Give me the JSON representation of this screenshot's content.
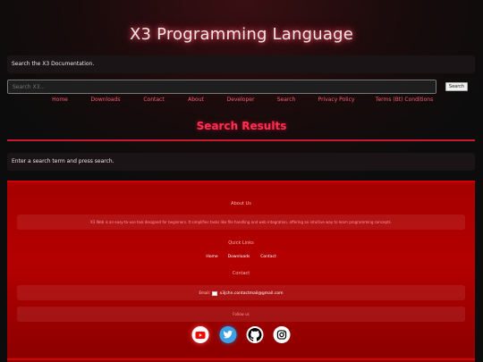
{
  "header": {
    "title": "X3 Programming Language"
  },
  "intro": {
    "text": "Search the X3 Documentation."
  },
  "search": {
    "placeholder": "Search X3...",
    "button_label": "Search"
  },
  "nav": {
    "items": [
      {
        "label": "Home"
      },
      {
        "label": "Downloads"
      },
      {
        "label": "Contact"
      },
      {
        "label": "About"
      },
      {
        "label": "Developer"
      },
      {
        "label": "Search"
      },
      {
        "label": "Privacy Policy"
      },
      {
        "label": "Terms (Bt) Conditions"
      }
    ]
  },
  "results": {
    "title": "Search Results",
    "message": "Enter a search term and press search."
  },
  "footer": {
    "about_heading": "About Us",
    "about_text": "X3 Web is an easy-to-use tool designed for beginners. It simplifies tasks like file handling and web integration, offering an intuitive way to learn programming concepts.",
    "quick_links_heading": "Quick Links",
    "quick_links": [
      {
        "label": "Home"
      },
      {
        "label": "Downloads"
      },
      {
        "label": "Contact"
      }
    ],
    "contact_heading": "Contact",
    "email_label": "Email:",
    "email": "x3jchn.contactmail@gmail.com",
    "follow_heading": "Follow us",
    "socials": [
      {
        "icon": "youtube-icon",
        "color": "#ff0000"
      },
      {
        "icon": "twitter-icon",
        "color": "#1da1f2"
      },
      {
        "icon": "github-icon",
        "color": "#000000"
      },
      {
        "icon": "instagram-icon",
        "color": "#000000"
      }
    ]
  }
}
